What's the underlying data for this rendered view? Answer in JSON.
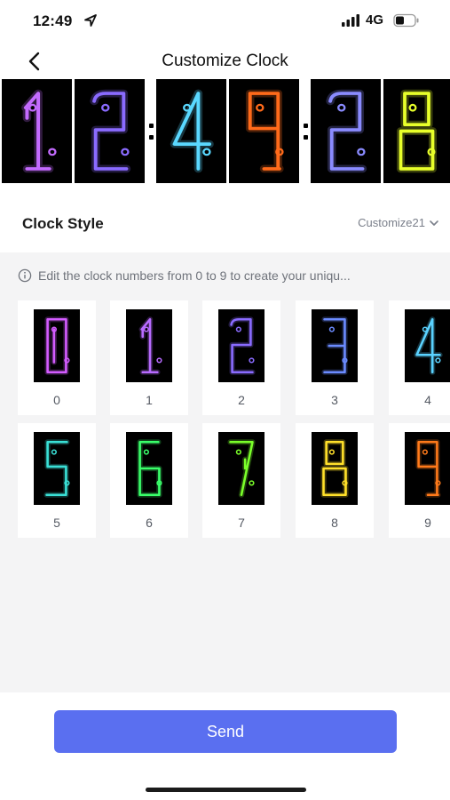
{
  "status": {
    "time": "12:49",
    "network": "4G"
  },
  "nav": {
    "title": "Customize Clock"
  },
  "preview": {
    "tiles": [
      {
        "digit": "1",
        "color": "#c46bff"
      },
      {
        "digit": "2",
        "color": "#8a6bff"
      },
      {
        "digit": "4",
        "color": "#5ad8ff"
      },
      {
        "digit": "9",
        "color": "#ff6a1a"
      },
      {
        "digit": "2",
        "color": "#8a8bff"
      },
      {
        "digit": "8",
        "color": "#e8ff2a"
      }
    ]
  },
  "clock_style": {
    "label": "Clock Style",
    "value": "Customize21"
  },
  "info_text": "Edit the clock numbers from 0 to 9 to create your uniqu...",
  "digits": [
    {
      "label": "0",
      "color": "#d35cff"
    },
    {
      "label": "1",
      "color": "#b86bff"
    },
    {
      "label": "2",
      "color": "#8a6bff"
    },
    {
      "label": "3",
      "color": "#6b8bff"
    },
    {
      "label": "4",
      "color": "#5ad2ff"
    },
    {
      "label": "5",
      "color": "#3ae0d6"
    },
    {
      "label": "6",
      "color": "#3aff6a"
    },
    {
      "label": "7",
      "color": "#7aff2a"
    },
    {
      "label": "8",
      "color": "#ffe02a"
    },
    {
      "label": "9",
      "color": "#ff7a1a"
    }
  ],
  "send_label": "Send"
}
